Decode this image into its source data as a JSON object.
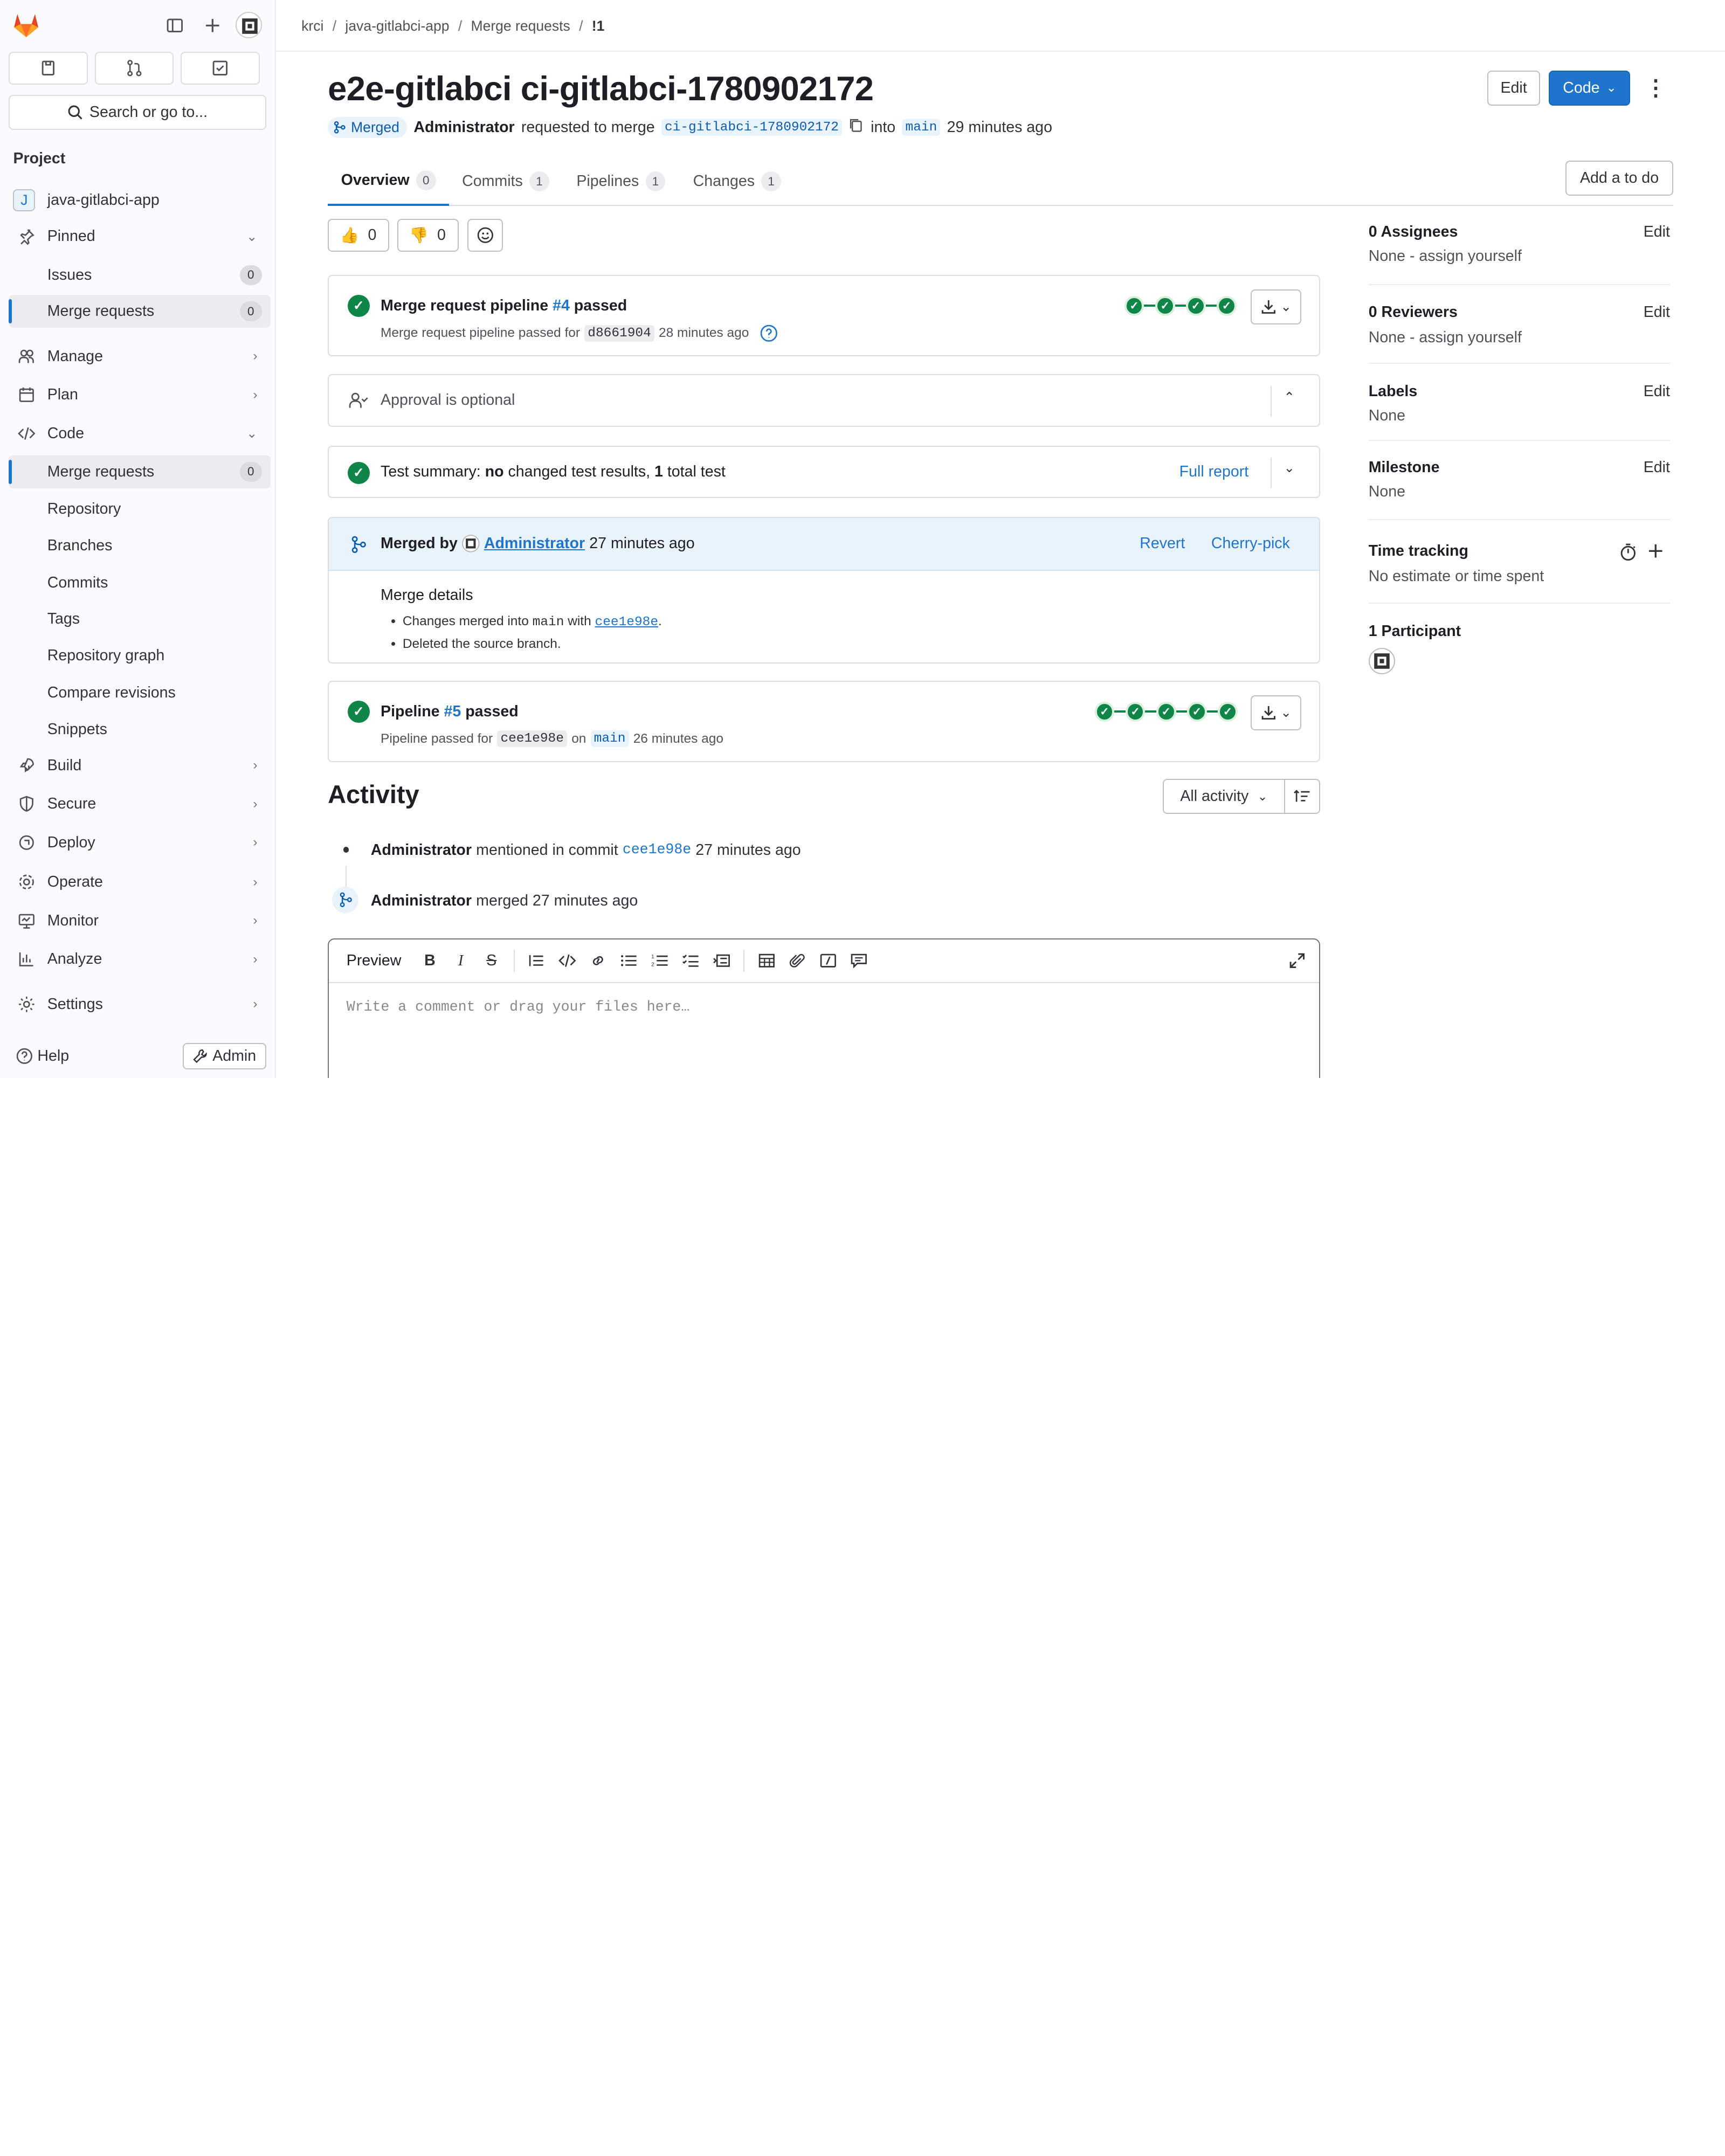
{
  "sidebar": {
    "search_label": "Search or go to...",
    "section_title": "Project",
    "project_name": "java-gitlabci-app",
    "project_initial": "J",
    "items": [
      {
        "label": "Pinned"
      },
      {
        "label": "Issues",
        "count": "0"
      },
      {
        "label": "Merge requests",
        "count": "0"
      },
      {
        "label": "Manage"
      },
      {
        "label": "Plan"
      },
      {
        "label": "Code"
      },
      {
        "label": "Merge requests",
        "count": "0"
      },
      {
        "label": "Repository"
      },
      {
        "label": "Branches"
      },
      {
        "label": "Commits"
      },
      {
        "label": "Tags"
      },
      {
        "label": "Repository graph"
      },
      {
        "label": "Compare revisions"
      },
      {
        "label": "Snippets"
      },
      {
        "label": "Build"
      },
      {
        "label": "Secure"
      },
      {
        "label": "Deploy"
      },
      {
        "label": "Operate"
      },
      {
        "label": "Monitor"
      },
      {
        "label": "Analyze"
      },
      {
        "label": "Settings"
      }
    ],
    "help_label": "Help",
    "admin_label": "Admin"
  },
  "breadcrumb": [
    "krci",
    "java-gitlabci-app",
    "Merge requests",
    "!1"
  ],
  "header": {
    "title": "e2e-gitlabci ci-gitlabci-1780902172",
    "status": "Merged",
    "author": "Administrator",
    "requested_text": "requested to merge",
    "source_branch": "ci-gitlabci-1780902172",
    "into_text": "into",
    "target_branch": "main",
    "time": "29 minutes ago",
    "edit_label": "Edit",
    "code_label": "Code",
    "add_todo_label": "Add a to do"
  },
  "tabs": [
    {
      "label": "Overview",
      "count": "0"
    },
    {
      "label": "Commits",
      "count": "1"
    },
    {
      "label": "Pipelines",
      "count": "1"
    },
    {
      "label": "Changes",
      "count": "1"
    }
  ],
  "reactions": {
    "thumbs_up": "0",
    "thumbs_down": "0"
  },
  "mr_pipeline": {
    "title_prefix": "Merge request pipeline",
    "id": "#4",
    "status": "passed",
    "sub_text": "Merge request pipeline passed for",
    "sha": "d8661904",
    "time": "28 minutes ago"
  },
  "approval": {
    "text": "Approval is optional"
  },
  "test_summary": {
    "prefix": "Test summary:",
    "changed": "no",
    "middle": "changed test results,",
    "total": "1",
    "suffix": "total test",
    "report_label": "Full report"
  },
  "merged": {
    "prefix": "Merged by",
    "user": "Administrator",
    "time": "27 minutes ago",
    "revert_label": "Revert",
    "cherry_label": "Cherry-pick",
    "details_title": "Merge details",
    "detail1_prefix": "Changes merged into",
    "detail1_branch": "main",
    "detail1_with": "with",
    "detail1_sha": "cee1e98e",
    "detail2": "Deleted the source branch."
  },
  "main_pipeline": {
    "title_prefix": "Pipeline",
    "id": "#5",
    "status": "passed",
    "sub_text": "Pipeline passed for",
    "sha": "cee1e98e",
    "on_text": "on",
    "branch": "main",
    "time": "26 minutes ago"
  },
  "activity": {
    "title": "Activity",
    "filter_label": "All activity",
    "events": [
      {
        "user": "Administrator",
        "text": "mentioned in commit",
        "link": "cee1e98e",
        "time": "27 minutes ago"
      },
      {
        "user": "Administrator",
        "text": "merged 27 minutes ago"
      }
    ]
  },
  "editor": {
    "preview_label": "Preview",
    "placeholder": "Write a comment or drag your files here…"
  },
  "right_panel": {
    "assignees_title": "0 Assignees",
    "assignees_value": "None - assign yourself",
    "reviewers_title": "0 Reviewers",
    "reviewers_value": "None - assign yourself",
    "labels_title": "Labels",
    "labels_value": "None",
    "milestone_title": "Milestone",
    "milestone_value": "None",
    "time_title": "Time tracking",
    "time_value": "No estimate or time spent",
    "participants_title": "1 Participant",
    "edit_label": "Edit"
  },
  "colors": {
    "brand": "#1f75cb",
    "success": "#108548",
    "merged_bg": "#e9f3fc"
  }
}
